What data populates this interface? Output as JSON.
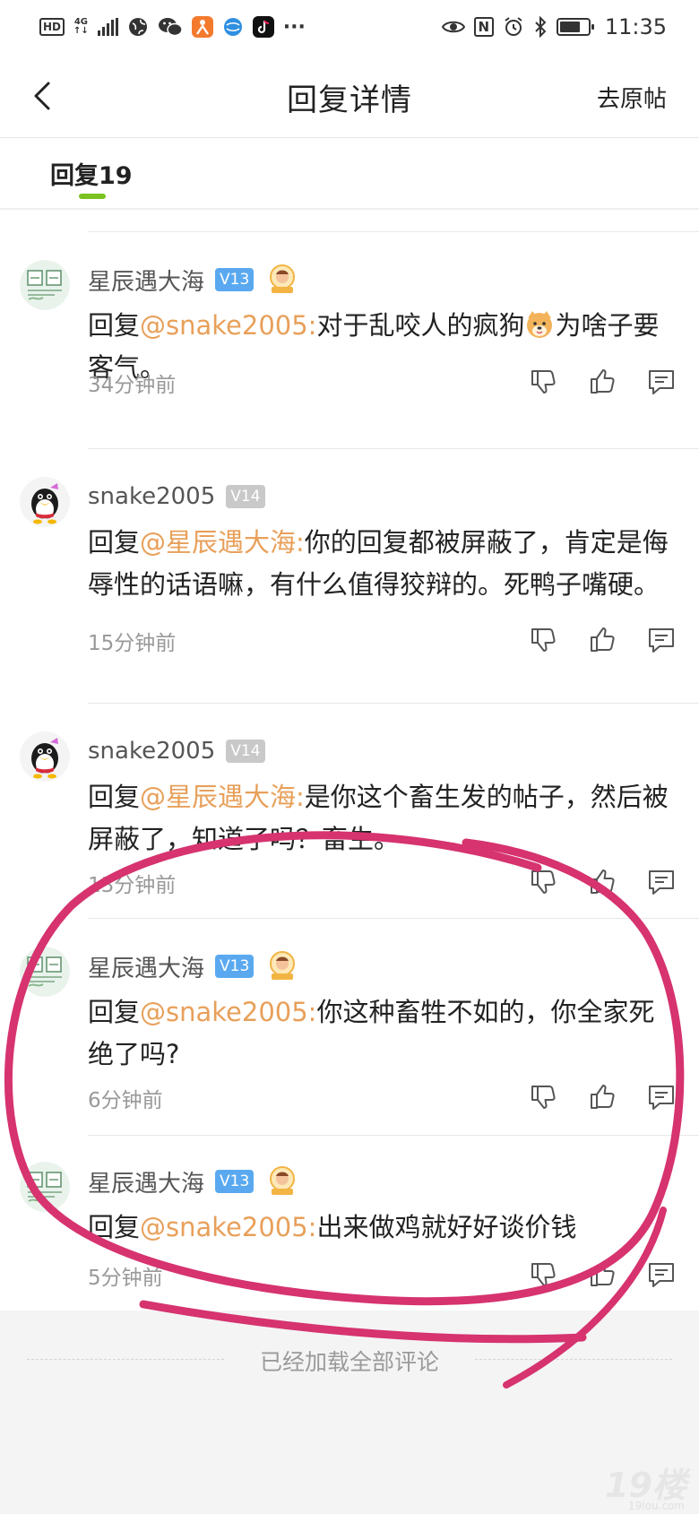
{
  "status_bar": {
    "hd": "HD",
    "net_top": "4G",
    "net_bottom": "↑↓",
    "time": "11:35",
    "icons": [
      "hd-icon",
      "signal-icon",
      "globe-icon",
      "wechat-icon",
      "app-icon",
      "browser-icon",
      "tiktok-icon",
      "more-icon",
      "eye-icon",
      "nfc-icon",
      "alarm-icon",
      "bluetooth-icon",
      "battery-icon"
    ],
    "more": "···",
    "nfc": "N"
  },
  "header": {
    "title": "回复详情",
    "go_original": "去原帖",
    "back_icon": "chevron-left-icon"
  },
  "tab": {
    "label": "回复19",
    "accent": "#7ac21f"
  },
  "colors": {
    "mention": "#e8a05a",
    "level_blue": "#5aa9f0",
    "level_grey": "#c9c9c9",
    "annotation": "#d6336f"
  },
  "replies": [
    {
      "author": "星辰遇大海",
      "level": "V13",
      "prefix": "回复",
      "mention": "@snake2005:",
      "text_a": "对于乱咬人的疯狗",
      "emoji": "dog-face-emoji",
      "text_b": "为啥子要客气。",
      "time": "34分钟前"
    },
    {
      "author": "snake2005",
      "level": "V14",
      "prefix": "回复",
      "mention": "@星辰遇大海:",
      "text_a": "你的回复都被屏蔽了，肯定是侮辱性的话语嘛，有什么值得狡辩的。死鸭子嘴硬。",
      "time": "15分钟前"
    },
    {
      "author": "snake2005",
      "level": "V14",
      "prefix": "回复",
      "mention": "@星辰遇大海:",
      "text_a": "是你这个畜生发的帖子，然后被屏蔽了，知道了吗？畜生。",
      "time": "13分钟前"
    },
    {
      "author": "星辰遇大海",
      "level": "V13",
      "prefix": "回复",
      "mention": "@snake2005:",
      "text_a": "你这种畜牲不如的，你全家死绝了吗?",
      "time": "6分钟前"
    },
    {
      "author": "星辰遇大海",
      "level": "V13",
      "prefix": "回复",
      "mention": "@snake2005:",
      "text_a": "出来做鸡就好好谈价钱",
      "time": "5分钟前"
    }
  ],
  "footer": {
    "loaded_all": "已经加载全部评论",
    "watermark": "19楼",
    "watermark_sub": "19lou.com"
  }
}
